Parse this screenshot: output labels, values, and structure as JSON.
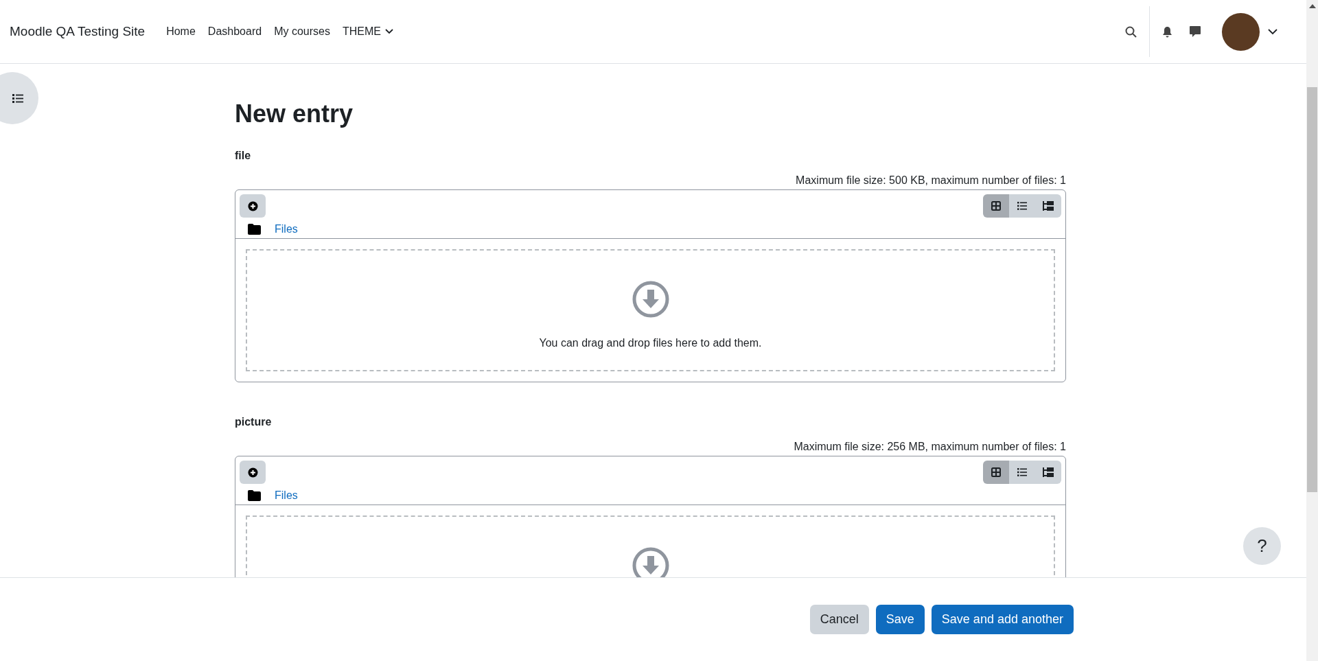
{
  "navbar": {
    "site_name": "Moodle QA Testing Site",
    "links": [
      {
        "label": "Home",
        "kind": "link"
      },
      {
        "label": "Dashboard",
        "kind": "link"
      },
      {
        "label": "My courses",
        "kind": "link"
      },
      {
        "label": "THEME",
        "kind": "dropdown"
      }
    ]
  },
  "page": {
    "title": "New entry"
  },
  "fields": [
    {
      "label": "file",
      "limits": "Maximum file size: 500 KB, maximum number of files: 1",
      "folder_link": "Files",
      "view_modes": [
        {
          "kind": "icons",
          "selected": true
        },
        {
          "kind": "details",
          "selected": false
        },
        {
          "kind": "tree",
          "selected": false
        }
      ],
      "drop_message": "You can drag and drop files here to add them."
    },
    {
      "label": "picture",
      "limits": "Maximum file size: 256 MB, maximum number of files: 1",
      "folder_link": "Files",
      "view_modes": [
        {
          "kind": "icons",
          "selected": true
        },
        {
          "kind": "details",
          "selected": false
        },
        {
          "kind": "tree",
          "selected": false
        }
      ]
    }
  ],
  "footer": {
    "buttons": [
      {
        "label": "Cancel",
        "kind": "secondary"
      },
      {
        "label": "Save",
        "kind": "primary"
      },
      {
        "label": "Save and add another",
        "kind": "primary"
      }
    ]
  },
  "help_button": {
    "label": "?"
  }
}
